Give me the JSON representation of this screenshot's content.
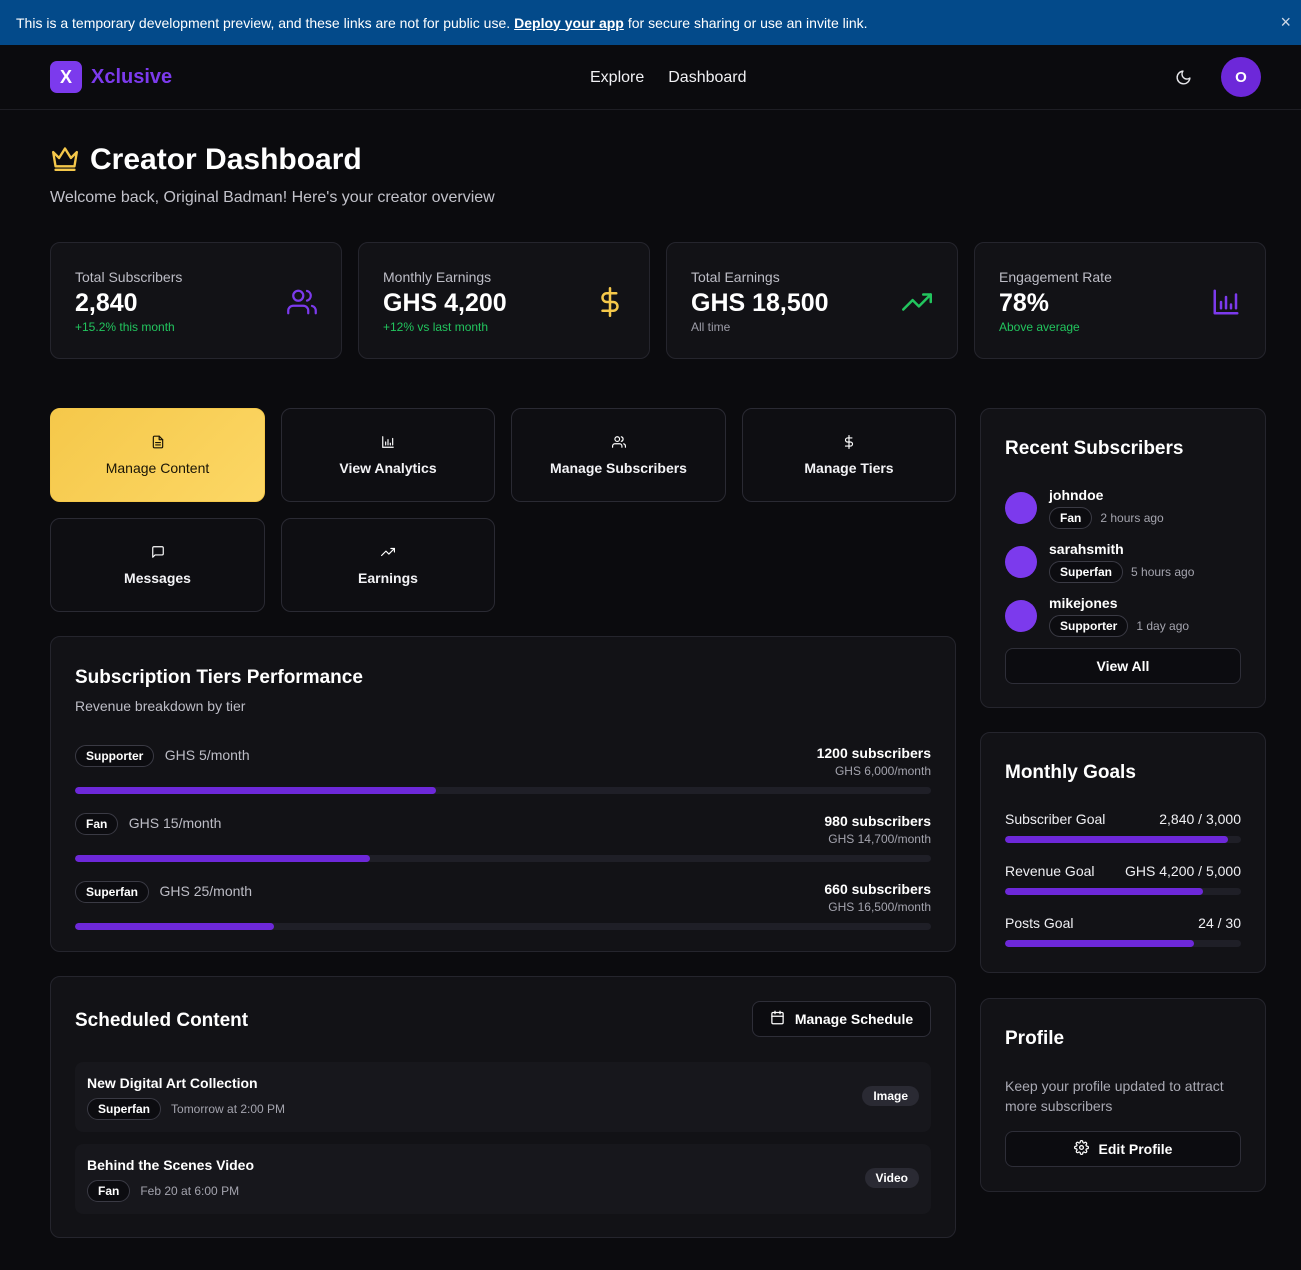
{
  "banner": {
    "text_before": "This is a temporary development preview, and these links are not for public use.",
    "link": "Deploy your app",
    "text_after": "for secure sharing or use an invite link.",
    "close": "×"
  },
  "nav": {
    "logo_letter": "X",
    "brand": "Xclusive",
    "links": [
      "Explore",
      "Dashboard"
    ],
    "avatar_initial": "O"
  },
  "header": {
    "title": "Creator Dashboard",
    "subtitle": "Welcome back, Original Badman! Here's your creator overview"
  },
  "stats": [
    {
      "label": "Total Subscribers",
      "value": "2,840",
      "sub": "+15.2% this month",
      "icon": "users-icon",
      "color": "#7c3aed"
    },
    {
      "label": "Monthly Earnings",
      "value": "GHS 4,200",
      "sub": "+12% vs last month",
      "icon": "dollar-icon",
      "color": "#f5c84a"
    },
    {
      "label": "Total Earnings",
      "value": "GHS 18,500",
      "sub": "All time",
      "icon": "trending-up-icon",
      "color": "#22c55e"
    },
    {
      "label": "Engagement Rate",
      "value": "78%",
      "sub": "Above average",
      "icon": "bar-chart-icon",
      "color": "#7c3aed"
    }
  ],
  "actions": [
    {
      "label": "Manage Content",
      "icon": "file-text-icon",
      "active": true
    },
    {
      "label": "View Analytics",
      "icon": "bar-chart-icon"
    },
    {
      "label": "Manage Subscribers",
      "icon": "users-icon"
    },
    {
      "label": "Manage Tiers",
      "icon": "dollar-icon"
    },
    {
      "label": "Messages",
      "icon": "message-square-icon"
    },
    {
      "label": "Earnings",
      "icon": "trending-up-icon"
    }
  ],
  "tiers": {
    "title": "Subscription Tiers Performance",
    "subtitle": "Revenue breakdown by tier",
    "items": [
      {
        "name": "Supporter",
        "price": "GHS 5/month",
        "subscribers": "1200 subscribers",
        "revenue": "GHS 6,000/month",
        "progress": 0.422
      },
      {
        "name": "Fan",
        "price": "GHS 15/month",
        "subscribers": "980 subscribers",
        "revenue": "GHS 14,700/month",
        "progress": 0.345
      },
      {
        "name": "Superfan",
        "price": "GHS 25/month",
        "subscribers": "660 subscribers",
        "revenue": "GHS 16,500/month",
        "progress": 0.232
      }
    ]
  },
  "scheduled": {
    "title": "Scheduled Content",
    "button": "Manage Schedule",
    "items": [
      {
        "title": "New Digital Art Collection",
        "tier": "Superfan",
        "when": "Tomorrow at 2:00 PM",
        "type": "Image"
      },
      {
        "title": "Behind the Scenes Video",
        "tier": "Fan",
        "when": "Feb 20 at 6:00 PM",
        "type": "Video"
      }
    ]
  },
  "recent": {
    "title": "Recent Subscribers",
    "items": [
      {
        "name": "johndoe",
        "tier": "Fan",
        "time": "2 hours ago"
      },
      {
        "name": "sarahsmith",
        "tier": "Superfan",
        "time": "5 hours ago"
      },
      {
        "name": "mikejones",
        "tier": "Supporter",
        "time": "1 day ago"
      }
    ],
    "button": "View All"
  },
  "goals": {
    "title": "Monthly Goals",
    "items": [
      {
        "label": "Subscriber Goal",
        "value": "2,840 / 3,000",
        "progress": 0.947
      },
      {
        "label": "Revenue Goal",
        "value": "GHS 4,200 / 5,000",
        "progress": 0.84
      },
      {
        "label": "Posts Goal",
        "value": "24 / 30",
        "progress": 0.8
      }
    ]
  },
  "profile": {
    "title": "Profile",
    "text": "Keep your profile updated to attract more subscribers",
    "button": "Edit Profile"
  }
}
